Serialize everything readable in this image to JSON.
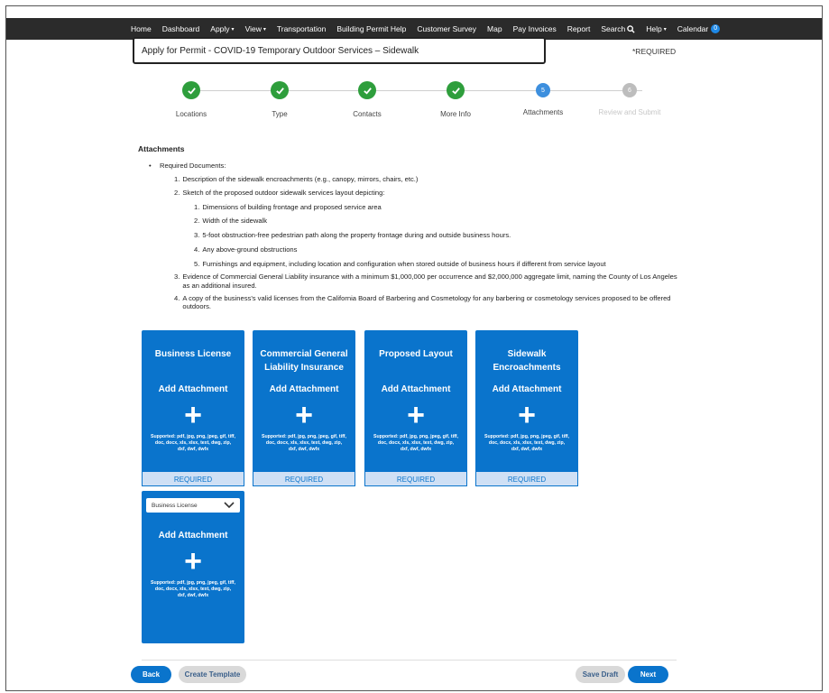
{
  "nav": {
    "items": [
      {
        "label": "Home"
      },
      {
        "label": "Dashboard"
      },
      {
        "label": "Apply",
        "caret": "▾"
      },
      {
        "label": "View",
        "caret": "▾"
      },
      {
        "label": "Transportation"
      },
      {
        "label": "Building Permit Help"
      },
      {
        "label": "Customer Survey"
      },
      {
        "label": "Map"
      },
      {
        "label": "Pay Invoices"
      },
      {
        "label": "Report"
      },
      {
        "label": "Search"
      },
      {
        "label": "Help",
        "caret": "▾"
      },
      {
        "label": "Calendar",
        "badge": "0"
      }
    ]
  },
  "page": {
    "title": "Apply for Permit - COVID-19 Temporary Outdoor Services – Sidewalk",
    "required_note": "*REQUIRED"
  },
  "stepper": {
    "steps": [
      {
        "label": "Locations",
        "state": "done"
      },
      {
        "label": "Type",
        "state": "done"
      },
      {
        "label": "Contacts",
        "state": "done"
      },
      {
        "label": "More Info",
        "state": "done"
      },
      {
        "label": "Attachments",
        "state": "active",
        "number": "5"
      },
      {
        "label": "Review and Submit",
        "state": "pending",
        "number": "6"
      }
    ]
  },
  "attachments": {
    "heading": "Attachments",
    "bullet": "Required Documents:",
    "items": [
      {
        "num": "1.",
        "text": "Description of the sidewalk encroachments (e.g., canopy, mirrors, chairs, etc.)"
      },
      {
        "num": "2.",
        "text": "Sketch of the proposed outdoor sidewalk services layout depicting:",
        "sub": [
          {
            "num": "1.",
            "text": "Dimensions of building frontage and proposed service area"
          },
          {
            "num": "2.",
            "text": "Width of the sidewalk"
          },
          {
            "num": "3.",
            "text": "5-foot obstruction-free pedestrian path along the property frontage during and outside business hours."
          },
          {
            "num": "4.",
            "text": "Any above-ground obstructions"
          },
          {
            "num": "5.",
            "text": "Furnishings and equipment, including location and configuration when stored outside of business hours if different from service layout"
          }
        ]
      },
      {
        "num": "3.",
        "text": "Evidence of Commercial General Liability insurance with a minimum $1,000,000 per occurrence and $2,000,000 aggregate limit, naming the County of Los Angeles as an additional insured."
      },
      {
        "num": "4.",
        "text": "A copy of the business's valid licenses from the California Board of Barbering and Cosmetology for any barbering or cosmetology services proposed to be offered outdoors."
      }
    ]
  },
  "cards": {
    "add_label": "Add Attachment",
    "plus": "+",
    "supported": "Supported: pdf, jpg, png, jpeg, gif, tiff, doc, docx, xls, xlsx, text, dwg, zip, dxf, dwf, dwfx",
    "required_label": "REQUIRED",
    "items": [
      {
        "title": "Business License"
      },
      {
        "title": "Commercial General Liability Insurance"
      },
      {
        "title": "Proposed Layout"
      },
      {
        "title": "Sidewalk Encroachments"
      }
    ],
    "extra_select": "Business License"
  },
  "buttons": {
    "back": "Back",
    "create_template": "Create Template",
    "save_draft": "Save Draft",
    "next": "Next"
  },
  "colors": {
    "nav_bg": "#2b2b2b",
    "card_blue": "#0a74cc",
    "step_done": "#2e9e3c",
    "step_active": "#3d8fde",
    "step_pending": "#bdbdbd"
  }
}
